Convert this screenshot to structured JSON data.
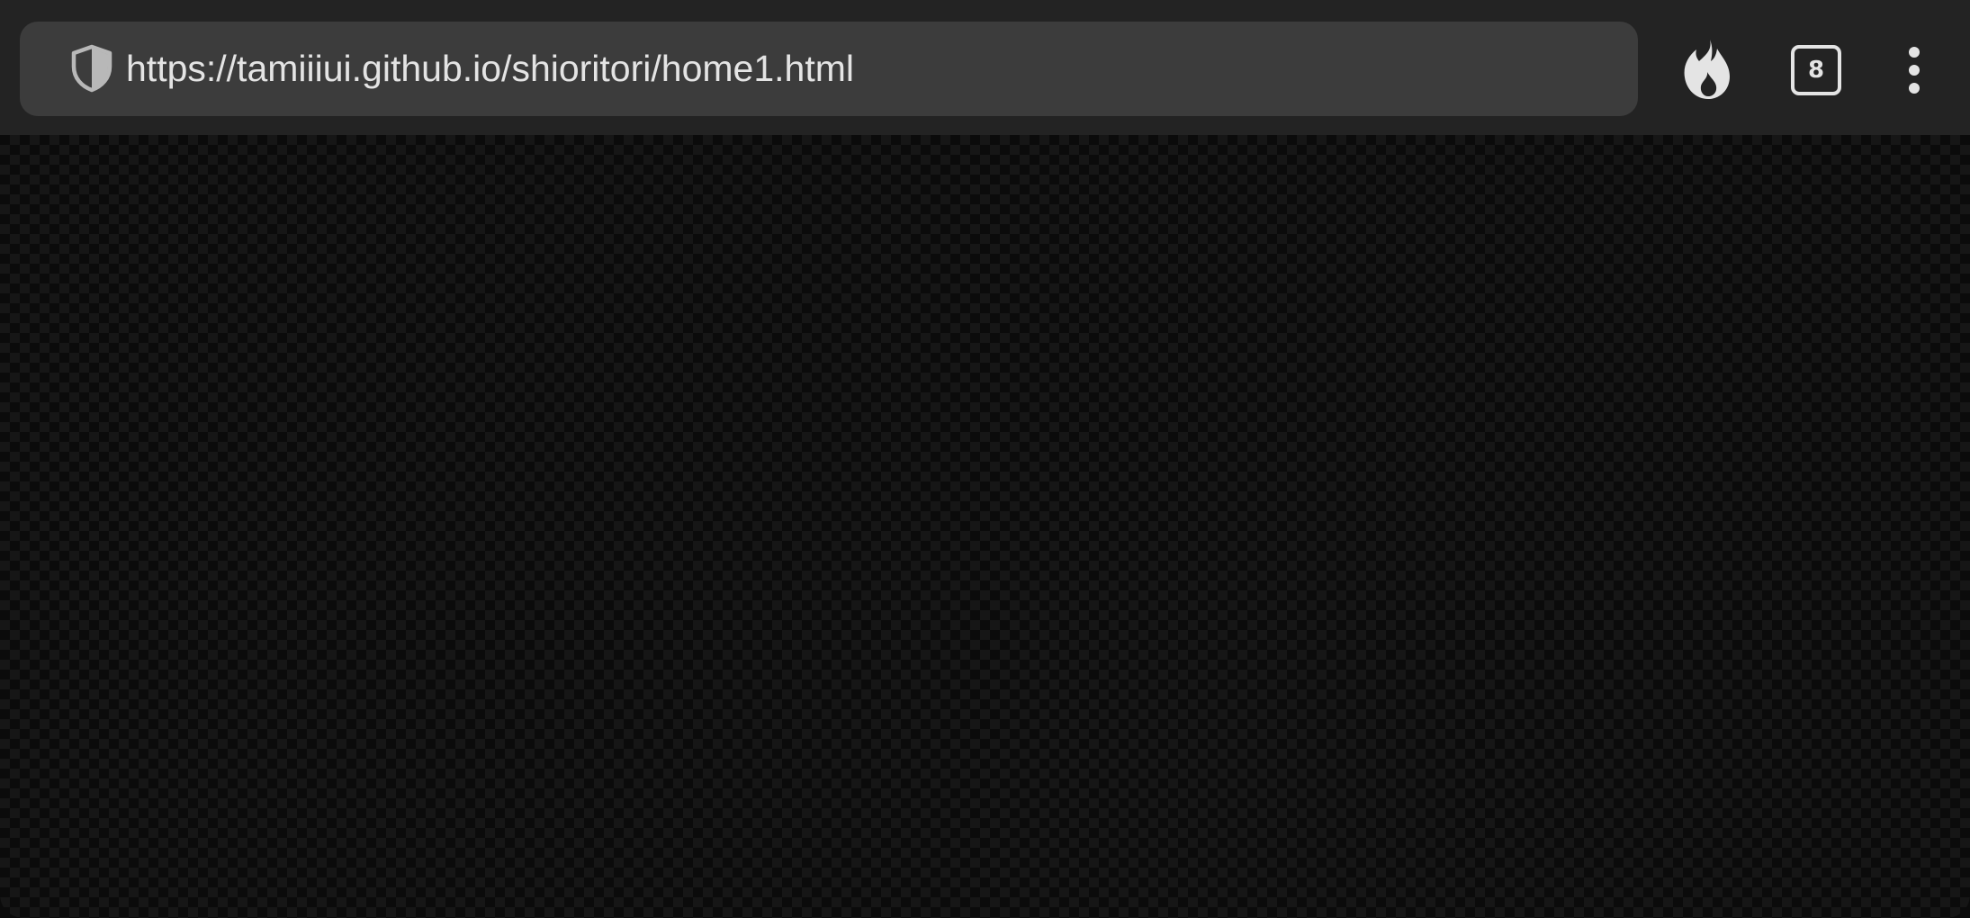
{
  "browser": {
    "address_bar": {
      "url": "https://tamiiiui.github.io/shioritori/home1.html",
      "security_icon": "shield-icon"
    },
    "toolbar": {
      "fire_icon": "fire-icon",
      "tab_count": "8",
      "menu_icon": "more-vertical-icon"
    },
    "colors": {
      "toolbar_bg": "#232323",
      "urlbar_bg": "#3c3c3c",
      "text": "#e4e4e4",
      "page_bg": "#0b0b0b"
    }
  }
}
